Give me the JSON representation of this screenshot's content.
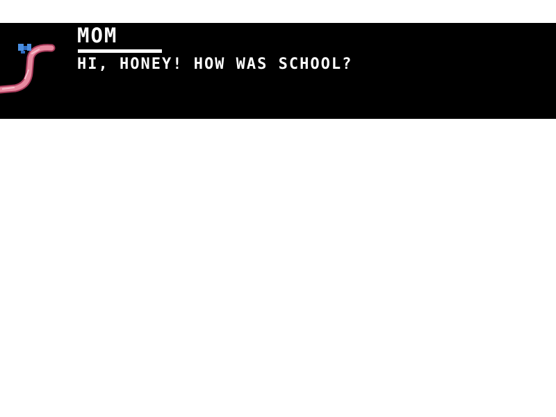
{
  "dialog": {
    "speaker": "MOM",
    "line": "HI, HONEY! HOW WAS SCHOOL?"
  },
  "portrait": {
    "icon": "worm-mom-portrait-icon",
    "body_color": "#e88aa0",
    "outline_color": "#a83a5a",
    "bow_color": "#4a8ee0"
  },
  "colors": {
    "dialog_background": "#000000",
    "dialog_text": "#ffffff",
    "page_background": "#ffffff"
  }
}
